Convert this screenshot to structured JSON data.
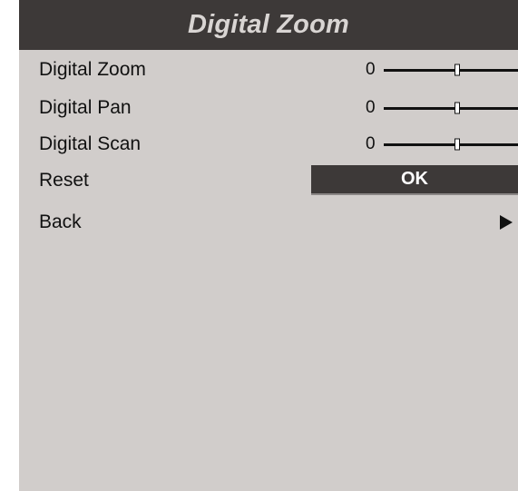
{
  "title": "Digital Zoom",
  "items": [
    {
      "label": "Digital Zoom",
      "value": "0",
      "level": 0.55
    },
    {
      "label": "Digital Pan",
      "value": "0",
      "level": 0.55
    },
    {
      "label": "Digital Scan",
      "value": "0",
      "level": 0.55
    }
  ],
  "reset": {
    "label": "Reset",
    "button_label": "OK"
  },
  "back": {
    "label": "Back",
    "icon": "arrow-right-icon"
  },
  "colors": {
    "panel_background": "#d1cdcb",
    "title_bar": "#3d3938",
    "title_text": "#d9d5d3",
    "button_background": "#3d3938",
    "text": "#111111"
  }
}
